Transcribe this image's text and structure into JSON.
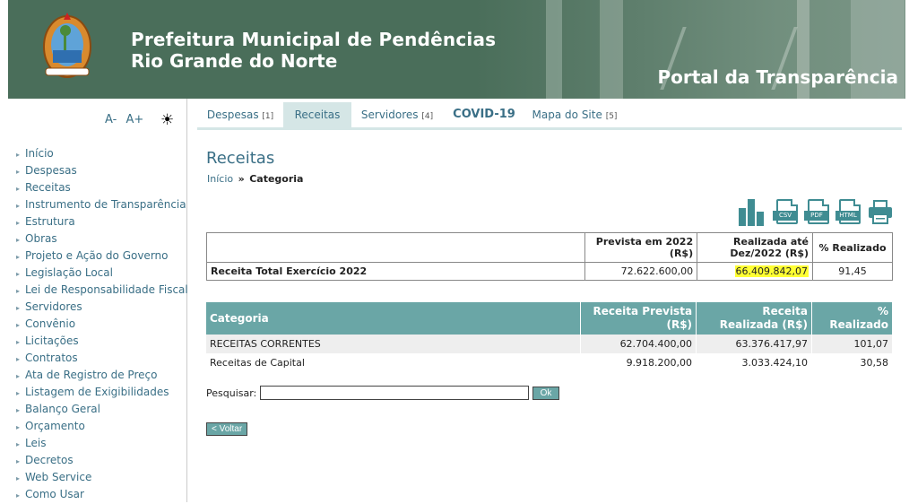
{
  "header": {
    "title_line1": "Prefeitura Municipal de Pendências",
    "title_line2": "Rio Grande do Norte",
    "portal": "Portal da Transparência",
    "crest_icon": "municipal-crest-icon"
  },
  "sidebar": {
    "font_decrease": "A-",
    "font_increase": "A+",
    "contrast_icon": "sun-icon",
    "items": [
      "Início",
      "Despesas",
      "Receitas",
      "Instrumento de Transparência",
      "Estrutura",
      "Obras",
      "Projeto e Ação do Governo",
      "Legislação Local",
      "Lei de Responsabilidade Fiscal",
      "Servidores",
      "Convênio",
      "Licitações",
      "Contratos",
      "Ata de Registro de Preço",
      "Listagem de Exigibilidades",
      "Balanço Geral",
      "Orçamento",
      "Leis",
      "Decretos",
      "Web Service",
      "Como Usar"
    ]
  },
  "tabs": [
    {
      "label": "Despesas",
      "key": "[1]"
    },
    {
      "label": "Receitas",
      "key": ""
    },
    {
      "label": "Servidores",
      "key": "[4]"
    },
    {
      "label": "COVID-19",
      "key": ""
    },
    {
      "label": "Mapa do Site",
      "key": "[5]"
    }
  ],
  "page": {
    "title": "Receitas",
    "breadcrumb_home": "Início",
    "breadcrumb_sep": "»",
    "breadcrumb_current": "Categoria"
  },
  "exports": [
    "CSV",
    "PDF",
    "HTML"
  ],
  "summary": {
    "headers": [
      "",
      "Prevista em 2022 (R$)",
      "Realizada até Dez/2022 (R$)",
      "% Realizado"
    ],
    "row": [
      "Receita Total Exercício 2022",
      "72.622.600,00",
      "66.409.842,07",
      "91,45"
    ]
  },
  "categories": {
    "headers": [
      "Categoria",
      "Receita Prevista (R$)",
      "Receita Realizada (R$)",
      "% Realizado"
    ],
    "rows": [
      [
        "RECEITAS CORRENTES",
        "62.704.400,00",
        "63.376.417,97",
        "101,07"
      ],
      [
        "Receitas de Capital",
        "9.918.200,00",
        "3.033.424,10",
        "30,58"
      ]
    ]
  },
  "search": {
    "label": "Pesquisar:",
    "value": "",
    "button": "Ok"
  },
  "back_button": "< Voltar",
  "colors": {
    "header_bg": "#4a6e5a",
    "link": "#3a6f86",
    "table_header": "#6aa6a6",
    "highlight": "#ffff33"
  }
}
